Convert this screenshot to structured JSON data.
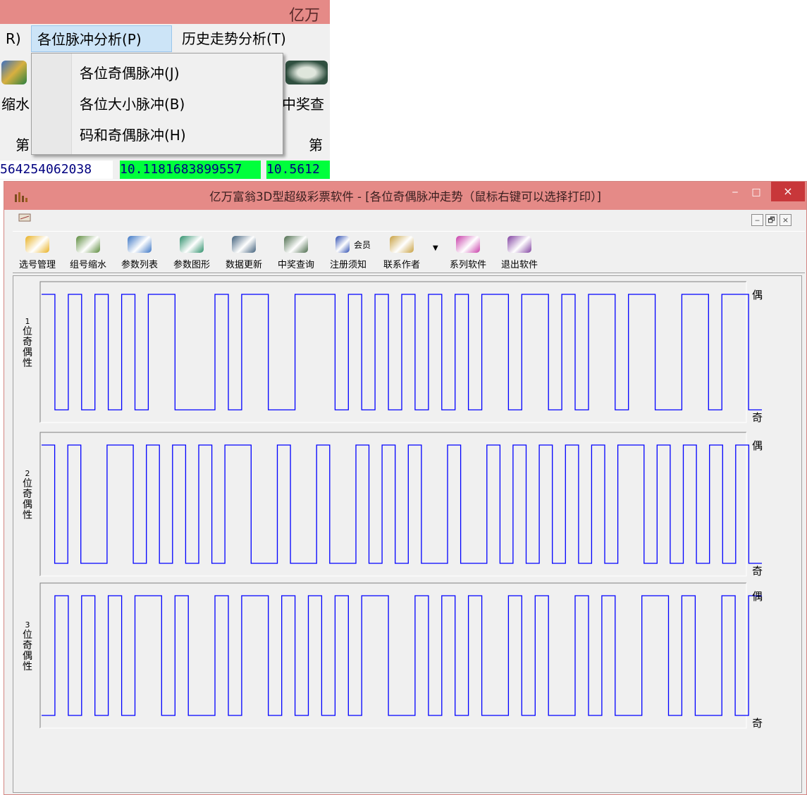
{
  "background_window": {
    "title_fragment": "亿万",
    "menu": [
      "R)",
      "各位脉冲分析(P)",
      "历史走势分析(T)"
    ],
    "toolbar_labels": [
      "缩水",
      "中奖查"
    ],
    "row_labels": [
      "第",
      "第"
    ],
    "row_values": [
      "564254062038",
      "10.1181683899557",
      "10.5612"
    ]
  },
  "dropdown_menu": {
    "items": [
      "各位奇偶脉冲(J)",
      "各位大小脉冲(B)",
      "码和奇偶脉冲(H)"
    ]
  },
  "main_window": {
    "title": "亿万富翁3D型超级彩票软件 - [各位奇偶脉冲走势（鼠标右键可以选择打印）]",
    "window_buttons": [
      "‒",
      "□",
      "×"
    ],
    "mdi_buttons": [
      "‒",
      "🗗",
      "×"
    ],
    "toolbar": [
      {
        "label": "选号管理",
        "icon": "select-number-icon",
        "color": "#e8b020"
      },
      {
        "label": "组号缩水",
        "icon": "books-icon",
        "color": "#5a8a3a"
      },
      {
        "label": "参数列表",
        "icon": "list-icon",
        "color": "#3a74c4"
      },
      {
        "label": "参数图形",
        "icon": "chart-books-icon",
        "color": "#2c8f6a"
      },
      {
        "label": "数据更新",
        "icon": "computer-icon",
        "color": "#3f5f7a"
      },
      {
        "label": "中奖查询",
        "icon": "globe-icon",
        "color": "#4a6a4a"
      },
      {
        "label": "注册须知",
        "icon": "member-icon",
        "color": "#2a4ab0",
        "extra": "会员"
      },
      {
        "label": "联系作者",
        "icon": "envelope-icon",
        "color": "#c8a040"
      },
      {
        "label": "系列软件",
        "icon": "hot-icon",
        "color": "#c83ca8"
      },
      {
        "label": "退出软件",
        "icon": "go-icon",
        "color": "#8040a0"
      }
    ]
  },
  "chart_data": [
    {
      "type": "line",
      "title": "1位奇偶性",
      "y_top_label": "偶",
      "y_bottom_label": "奇",
      "color": "#0000ff",
      "values": [
        1,
        0,
        1,
        0,
        1,
        0,
        1,
        0,
        1,
        1,
        0,
        0,
        0,
        1,
        0,
        1,
        1,
        0,
        0,
        1,
        1,
        1,
        0,
        1,
        0,
        1,
        0,
        1,
        0,
        1,
        0,
        1,
        0,
        1,
        1,
        0,
        1,
        1,
        0,
        1,
        0,
        1,
        1,
        0,
        1,
        1,
        0,
        0,
        1,
        1,
        0,
        1,
        1,
        0
      ]
    },
    {
      "type": "line",
      "title": "2位奇偶性",
      "y_top_label": "偶",
      "y_bottom_label": "奇",
      "color": "#0000ff",
      "values": [
        1,
        0,
        1,
        0,
        0,
        1,
        1,
        0,
        1,
        0,
        1,
        0,
        1,
        0,
        1,
        1,
        0,
        0,
        1,
        0,
        0,
        1,
        0,
        0,
        1,
        0,
        1,
        0,
        1,
        0,
        0,
        1,
        0,
        0,
        1,
        0,
        1,
        0,
        1,
        0,
        1,
        0,
        1,
        0,
        1,
        1,
        0,
        1,
        0,
        1,
        0,
        1,
        0,
        1,
        0
      ]
    },
    {
      "type": "line",
      "title": "3位奇偶性",
      "y_top_label": "偶",
      "y_bottom_label": "奇",
      "color": "#0000ff",
      "values": [
        0,
        1,
        0,
        1,
        0,
        1,
        0,
        1,
        1,
        0,
        1,
        0,
        0,
        1,
        0,
        1,
        1,
        0,
        1,
        0,
        1,
        0,
        1,
        0,
        1,
        1,
        0,
        0,
        1,
        0,
        1,
        0,
        1,
        0,
        0,
        1,
        0,
        1,
        0,
        0,
        1,
        0,
        1,
        0,
        0,
        1,
        1,
        0,
        1,
        0,
        0,
        1,
        0,
        1
      ]
    }
  ]
}
